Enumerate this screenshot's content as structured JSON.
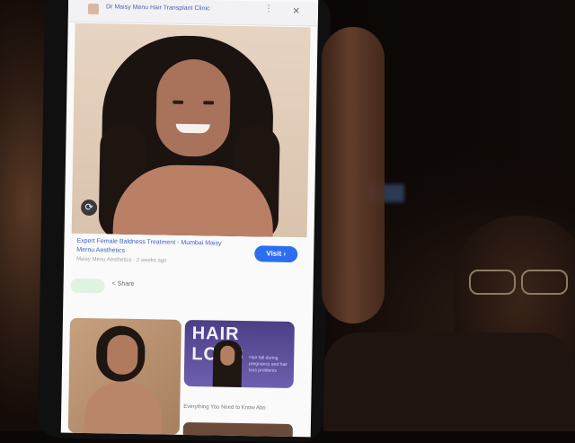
{
  "browser": {
    "site_title": "Dr Maisy Menu Hair Transplant Clinic",
    "menu_icon": "more-vert-icon",
    "close_glyph": "×"
  },
  "result": {
    "title": "Expert Female Baldness Treatment - Mumbai Maisy Mernu Aesthetics",
    "source": "Maisy Menu Aesthetics · 2 weeks ago",
    "visit_label": "Visit",
    "visit_arrow": "›"
  },
  "actions": {
    "share_label": "Share"
  },
  "related": {
    "hair_loss_title": "HAIR LOSS",
    "hair_loss_sub": "Hair fall during pregnancy and hair loss problems",
    "caption": "Everything You Need to Know Abo"
  },
  "colors": {
    "link_blue": "#4361c2",
    "visit_button": "#2d6ef0"
  }
}
